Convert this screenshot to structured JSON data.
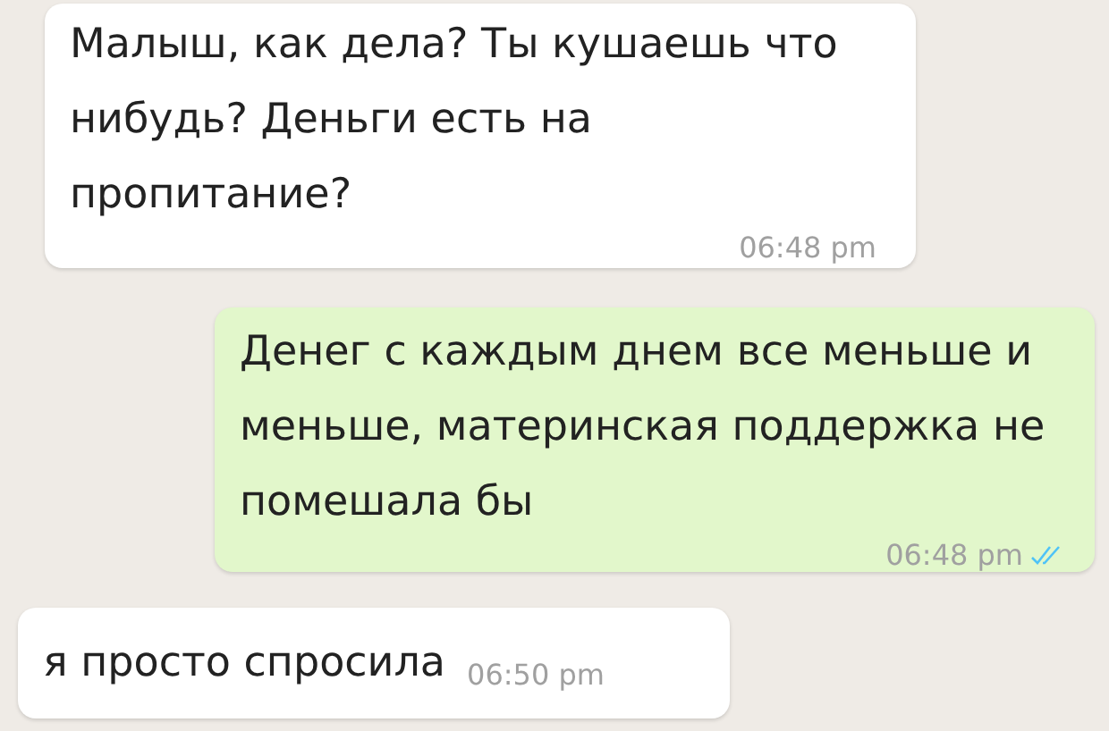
{
  "messages": [
    {
      "kind": "incoming",
      "text": "Малыш, как дела? Ты кушаешь что нибудь? Деньги есть на пропитание?",
      "time": "06:48 pm"
    },
    {
      "kind": "outgoing",
      "text": "Денег с каждым днем все меньше и меньше, материнская поддержка не помешала бы",
      "time": "06:48 pm",
      "read": true
    },
    {
      "kind": "incoming",
      "text": "я просто спросила",
      "time": "06:50 pm"
    }
  ]
}
